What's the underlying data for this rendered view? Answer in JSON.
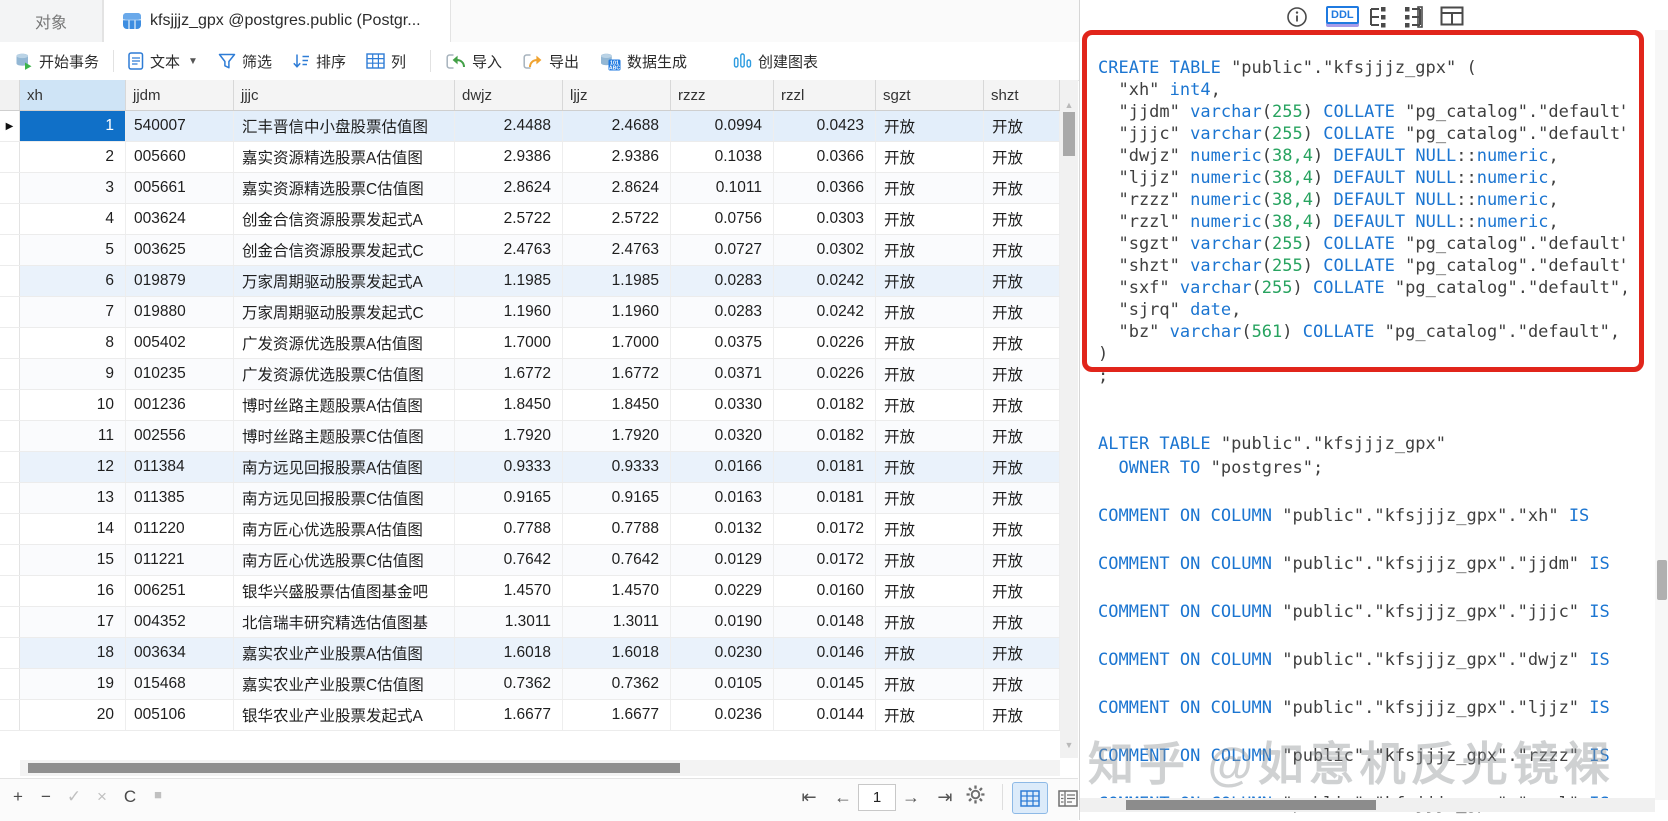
{
  "tabs": {
    "objects": "对象",
    "table_tab": "kfsjjjz_gpx @postgres.public (Postgr..."
  },
  "toolbar": {
    "begin_transaction": "开始事务",
    "text": "文本",
    "filter": "筛选",
    "sort": "排序",
    "columns": "列",
    "import": "导入",
    "export": "导出",
    "data_generation": "数据生成",
    "create_chart": "创建图表"
  },
  "grid": {
    "columns": [
      "xh",
      "jjdm",
      "jjjc",
      "dwjz",
      "ljjz",
      "rzzz",
      "rzzl",
      "sgzt",
      "shzt"
    ],
    "selected_row": 1,
    "rows": [
      [
        "1",
        "540007",
        "汇丰晋信中小盘股票估值图",
        "2.4488",
        "2.4688",
        "0.0994",
        "0.0423",
        "开放",
        "开放"
      ],
      [
        "2",
        "005660",
        "嘉实资源精选股票A估值图",
        "2.9386",
        "2.9386",
        "0.1038",
        "0.0366",
        "开放",
        "开放"
      ],
      [
        "3",
        "005661",
        "嘉实资源精选股票C估值图",
        "2.8624",
        "2.8624",
        "0.1011",
        "0.0366",
        "开放",
        "开放"
      ],
      [
        "4",
        "003624",
        "创金合信资源股票发起式A",
        "2.5722",
        "2.5722",
        "0.0756",
        "0.0303",
        "开放",
        "开放"
      ],
      [
        "5",
        "003625",
        "创金合信资源股票发起式C",
        "2.4763",
        "2.4763",
        "0.0727",
        "0.0302",
        "开放",
        "开放"
      ],
      [
        "6",
        "019879",
        "万家周期驱动股票发起式A",
        "1.1985",
        "1.1985",
        "0.0283",
        "0.0242",
        "开放",
        "开放"
      ],
      [
        "7",
        "019880",
        "万家周期驱动股票发起式C",
        "1.1960",
        "1.1960",
        "0.0283",
        "0.0242",
        "开放",
        "开放"
      ],
      [
        "8",
        "005402",
        "广发资源优选股票A估值图",
        "1.7000",
        "1.7000",
        "0.0375",
        "0.0226",
        "开放",
        "开放"
      ],
      [
        "9",
        "010235",
        "广发资源优选股票C估值图",
        "1.6772",
        "1.6772",
        "0.0371",
        "0.0226",
        "开放",
        "开放"
      ],
      [
        "10",
        "001236",
        "博时丝路主题股票A估值图",
        "1.8450",
        "1.8450",
        "0.0330",
        "0.0182",
        "开放",
        "开放"
      ],
      [
        "11",
        "002556",
        "博时丝路主题股票C估值图",
        "1.7920",
        "1.7920",
        "0.0320",
        "0.0182",
        "开放",
        "开放"
      ],
      [
        "12",
        "011384",
        "南方远见回报股票A估值图",
        "0.9333",
        "0.9333",
        "0.0166",
        "0.0181",
        "开放",
        "开放"
      ],
      [
        "13",
        "011385",
        "南方远见回报股票C估值图",
        "0.9165",
        "0.9165",
        "0.0163",
        "0.0181",
        "开放",
        "开放"
      ],
      [
        "14",
        "011220",
        "南方匠心优选股票A估值图",
        "0.7788",
        "0.7788",
        "0.0132",
        "0.0172",
        "开放",
        "开放"
      ],
      [
        "15",
        "011221",
        "南方匠心优选股票C估值图",
        "0.7642",
        "0.7642",
        "0.0129",
        "0.0172",
        "开放",
        "开放"
      ],
      [
        "16",
        "006251",
        "银华兴盛股票估值图基金吧",
        "1.4570",
        "1.4570",
        "0.0229",
        "0.0160",
        "开放",
        "开放"
      ],
      [
        "17",
        "004352",
        "北信瑞丰研究精选估值图基",
        "1.3011",
        "1.3011",
        "0.0190",
        "0.0148",
        "开放",
        "开放"
      ],
      [
        "18",
        "003634",
        "嘉实农业产业股票A估值图",
        "1.6018",
        "1.6018",
        "0.0230",
        "0.0146",
        "开放",
        "开放"
      ],
      [
        "19",
        "015468",
        "嘉实农业产业股票C估值图",
        "0.7362",
        "0.7362",
        "0.0105",
        "0.0145",
        "开放",
        "开放"
      ],
      [
        "20",
        "005106",
        "银华农业产业股票发起式A",
        "1.6677",
        "1.6677",
        "0.0236",
        "0.0144",
        "开放",
        "开放"
      ]
    ]
  },
  "footer": {
    "page": "1"
  },
  "ddl_panel": {
    "ddl_button": "DDL",
    "watermark": "知乎 @如意机反光镜裸",
    "sql_create": [
      [
        [
          "k",
          "CREATE TABLE"
        ],
        [
          "p",
          " \"public\".\"kfsjjjz_gpx\" ("
        ]
      ],
      [
        [
          "p",
          "  \"xh\" "
        ],
        [
          "k",
          "int4"
        ],
        [
          "p",
          ","
        ]
      ],
      [
        [
          "p",
          "  \"jjdm\" "
        ],
        [
          "k",
          "varchar"
        ],
        [
          "p",
          "("
        ],
        [
          "n",
          "255"
        ],
        [
          "p",
          ") "
        ],
        [
          "k",
          "COLLATE"
        ],
        [
          "p",
          " \"pg_catalog\".\"default\","
        ]
      ],
      [
        [
          "p",
          "  \"jjjc\" "
        ],
        [
          "k",
          "varchar"
        ],
        [
          "p",
          "("
        ],
        [
          "n",
          "255"
        ],
        [
          "p",
          ") "
        ],
        [
          "k",
          "COLLATE"
        ],
        [
          "p",
          " \"pg_catalog\".\"default\","
        ]
      ],
      [
        [
          "p",
          "  \"dwjz\" "
        ],
        [
          "k",
          "numeric"
        ],
        [
          "p",
          "("
        ],
        [
          "n",
          "38,4"
        ],
        [
          "p",
          ") "
        ],
        [
          "k",
          "DEFAULT NULL"
        ],
        [
          "p",
          "::"
        ],
        [
          "k",
          "numeric"
        ],
        [
          "p",
          ","
        ]
      ],
      [
        [
          "p",
          "  \"ljjz\" "
        ],
        [
          "k",
          "numeric"
        ],
        [
          "p",
          "("
        ],
        [
          "n",
          "38,4"
        ],
        [
          "p",
          ") "
        ],
        [
          "k",
          "DEFAULT NULL"
        ],
        [
          "p",
          "::"
        ],
        [
          "k",
          "numeric"
        ],
        [
          "p",
          ","
        ]
      ],
      [
        [
          "p",
          "  \"rzzz\" "
        ],
        [
          "k",
          "numeric"
        ],
        [
          "p",
          "("
        ],
        [
          "n",
          "38,4"
        ],
        [
          "p",
          ") "
        ],
        [
          "k",
          "DEFAULT NULL"
        ],
        [
          "p",
          "::"
        ],
        [
          "k",
          "numeric"
        ],
        [
          "p",
          ","
        ]
      ],
      [
        [
          "p",
          "  \"rzzl\" "
        ],
        [
          "k",
          "numeric"
        ],
        [
          "p",
          "("
        ],
        [
          "n",
          "38,4"
        ],
        [
          "p",
          ") "
        ],
        [
          "k",
          "DEFAULT NULL"
        ],
        [
          "p",
          "::"
        ],
        [
          "k",
          "numeric"
        ],
        [
          "p",
          ","
        ]
      ],
      [
        [
          "p",
          "  \"sgzt\" "
        ],
        [
          "k",
          "varchar"
        ],
        [
          "p",
          "("
        ],
        [
          "n",
          "255"
        ],
        [
          "p",
          ") "
        ],
        [
          "k",
          "COLLATE"
        ],
        [
          "p",
          " \"pg_catalog\".\"default\","
        ]
      ],
      [
        [
          "p",
          "  \"shzt\" "
        ],
        [
          "k",
          "varchar"
        ],
        [
          "p",
          "("
        ],
        [
          "n",
          "255"
        ],
        [
          "p",
          ") "
        ],
        [
          "k",
          "COLLATE"
        ],
        [
          "p",
          " \"pg_catalog\".\"default\","
        ]
      ],
      [
        [
          "p",
          "  \"sxf\" "
        ],
        [
          "k",
          "varchar"
        ],
        [
          "p",
          "("
        ],
        [
          "n",
          "255"
        ],
        [
          "p",
          ") "
        ],
        [
          "k",
          "COLLATE"
        ],
        [
          "p",
          " \"pg_catalog\".\"default\","
        ]
      ],
      [
        [
          "p",
          "  \"sjrq\" "
        ],
        [
          "k",
          "date"
        ],
        [
          "p",
          ","
        ]
      ],
      [
        [
          "p",
          "  \"bz\" "
        ],
        [
          "k",
          "varchar"
        ],
        [
          "p",
          "("
        ],
        [
          "n",
          "561"
        ],
        [
          "p",
          ") "
        ],
        [
          "k",
          "COLLATE"
        ],
        [
          "p",
          " \"pg_catalog\".\"default\","
        ]
      ],
      [
        [
          "p",
          ")"
        ]
      ],
      [
        [
          "p",
          ";"
        ]
      ]
    ],
    "sql_after": [
      [
        [
          "k",
          "ALTER TABLE"
        ],
        [
          "p",
          " \"public\".\"kfsjjjz_gpx\""
        ]
      ],
      [
        [
          "p",
          "  "
        ],
        [
          "k",
          "OWNER TO"
        ],
        [
          "p",
          " \"postgres\";"
        ]
      ],
      [],
      [
        [
          "k",
          "COMMENT ON COLUMN"
        ],
        [
          "p",
          " \"public\".\"kfsjjjz_gpx\".\"xh\" "
        ],
        [
          "k",
          "IS"
        ],
        [
          "p",
          " "
        ]
      ],
      [],
      [
        [
          "k",
          "COMMENT ON COLUMN"
        ],
        [
          "p",
          " \"public\".\"kfsjjjz_gpx\".\"jjdm\" "
        ],
        [
          "k",
          "IS"
        ],
        [
          "p",
          " "
        ]
      ],
      [],
      [
        [
          "k",
          "COMMENT ON COLUMN"
        ],
        [
          "p",
          " \"public\".\"kfsjjjz_gpx\".\"jjjc\" "
        ],
        [
          "k",
          "IS"
        ],
        [
          "p",
          " "
        ]
      ],
      [],
      [
        [
          "k",
          "COMMENT ON COLUMN"
        ],
        [
          "p",
          " \"public\".\"kfsjjjz_gpx\".\"dwjz\" "
        ],
        [
          "k",
          "IS"
        ],
        [
          "p",
          " "
        ]
      ],
      [],
      [
        [
          "k",
          "COMMENT ON COLUMN"
        ],
        [
          "p",
          " \"public\".\"kfsjjjz_gpx\".\"ljjz\" "
        ],
        [
          "k",
          "IS"
        ],
        [
          "p",
          " "
        ]
      ],
      [],
      [
        [
          "k",
          "COMMENT ON COLUMN"
        ],
        [
          "p",
          " \"public\".\"kfsjjjz_gpx\".\"rzzz\" "
        ],
        [
          "k",
          "IS"
        ],
        [
          "p",
          " "
        ]
      ],
      [],
      [
        [
          "k",
          "COMMENT ON COLUMN"
        ],
        [
          "p",
          " \"public\".\"kfsjjjz_gpx\".\"rzzl\" "
        ],
        [
          "k",
          "IS"
        ],
        [
          "p",
          " "
        ]
      ]
    ]
  },
  "colors": {
    "selection_blue": "#1070c8",
    "selection_row": "#e3eefa",
    "keyword_blue": "#1b75d1",
    "number_green": "#27a35f",
    "annotation_red": "#e1251b",
    "accent_blue": "#2e7cd6"
  }
}
